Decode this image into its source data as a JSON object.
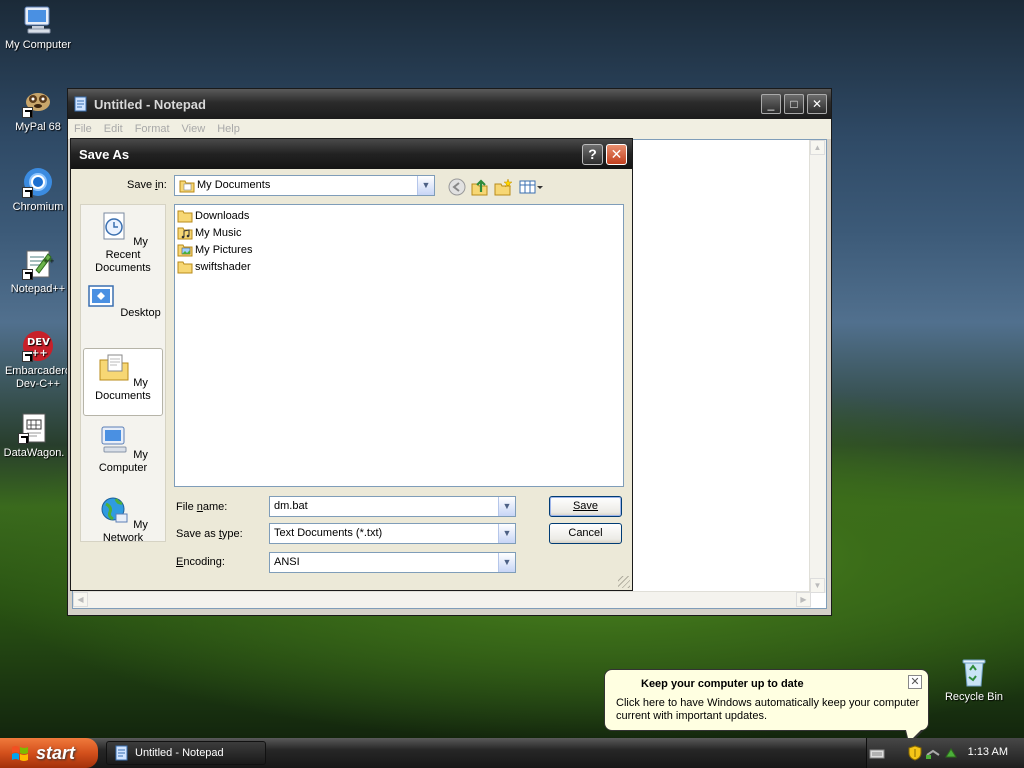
{
  "desktop": {
    "icons": [
      {
        "label": "My Computer",
        "icon": "my-computer-icon"
      },
      {
        "label": "MyPal 68",
        "icon": "mypal-icon"
      },
      {
        "label": "Chromium",
        "icon": "chromium-icon"
      },
      {
        "label": "Notepad++",
        "icon": "notepadpp-icon"
      },
      {
        "label": "Embarcadero Dev-C++",
        "icon": "devcpp-icon"
      },
      {
        "label": "DataWagon.",
        "icon": "datawagon-icon"
      },
      {
        "label": "Recycle Bin",
        "icon": "recycle-bin-icon"
      }
    ]
  },
  "notepad": {
    "title": "Untitled - Notepad",
    "menu": [
      "File",
      "Edit",
      "Format",
      "View",
      "Help"
    ],
    "controls": {
      "minimize": "_",
      "maximize": "□",
      "close": "✕"
    }
  },
  "dialog": {
    "title": "Save As",
    "help": "?",
    "close": "✕",
    "save_in_label": "Save in:",
    "save_in_value": "My Documents",
    "places": [
      "My Recent Documents",
      "Desktop",
      "My Documents",
      "My Computer",
      "My Network"
    ],
    "selected_place": "My Documents",
    "files": [
      "Downloads",
      "My Music",
      "My Pictures",
      "swiftshader"
    ],
    "file_name_label": "File name:",
    "file_name_value": "dm.bat",
    "save_type_label": "Save as type:",
    "save_type_value": "Text Documents (*.txt)",
    "encoding_label": "Encoding:",
    "encoding_value": "ANSI",
    "save_button": "Save",
    "cancel_button": "Cancel"
  },
  "taskbar": {
    "start_label": "start",
    "task_label": "Untitled - Notepad",
    "clock": "1:13 AM"
  },
  "balloon": {
    "title": "Keep your computer up to date",
    "text": "Click here to have Windows automatically keep your computer current with important updates.",
    "close": "✕"
  }
}
